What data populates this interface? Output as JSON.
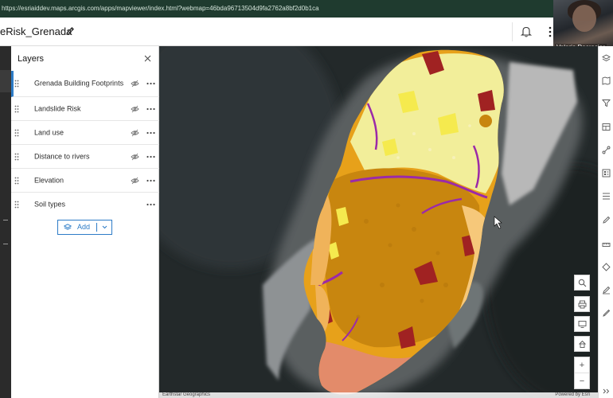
{
  "browser": {
    "url": "https://esriaiddev.maps.arcgis.com/apps/mapviewer/index.html?webmap=46bda96713504d9fa2762a8bf2d0b1ca"
  },
  "app": {
    "title": "eRisk_Grenada"
  },
  "webcam": {
    "name": "Valerie Desrosier"
  },
  "layers_panel": {
    "title": "Layers",
    "layers": [
      {
        "name": "Grenada Building Footprints",
        "visible": false
      },
      {
        "name": "Landslide Risk",
        "visible": false
      },
      {
        "name": "Land use",
        "visible": false
      },
      {
        "name": "Distance to rivers",
        "visible": false
      },
      {
        "name": "Elevation",
        "visible": false
      },
      {
        "name": "Soil types",
        "visible": true
      }
    ],
    "add_label": "Add"
  },
  "map": {
    "attribution_left": "Earthstar Geographics",
    "attribution_right": "Powered by Esri",
    "zoom_in": "+",
    "zoom_out": "−",
    "soil_colors": [
      "#c8860f",
      "#e7a11a",
      "#f0b35a",
      "#f6c87a",
      "#a02222",
      "#9b2aa8",
      "#f2ee9a",
      "#f5ea4e",
      "#e38b6a"
    ]
  },
  "icons": {
    "header": [
      "edit-icon",
      "bell-icon",
      "more-icon"
    ],
    "map_tools": [
      "search-icon",
      "print-icon",
      "screen-icon",
      "home-icon"
    ],
    "right_tools": [
      "layers-tool-icon",
      "basemap-tool-icon",
      "filter-tool-icon",
      "table-tool-icon",
      "analysis-tool-icon",
      "legend-tool-icon",
      "bookmarks-tool-icon",
      "sketch-tool-icon",
      "measure-tool-icon",
      "directions-tool-icon",
      "edit-tool-icon",
      "settings-tool-icon"
    ]
  }
}
